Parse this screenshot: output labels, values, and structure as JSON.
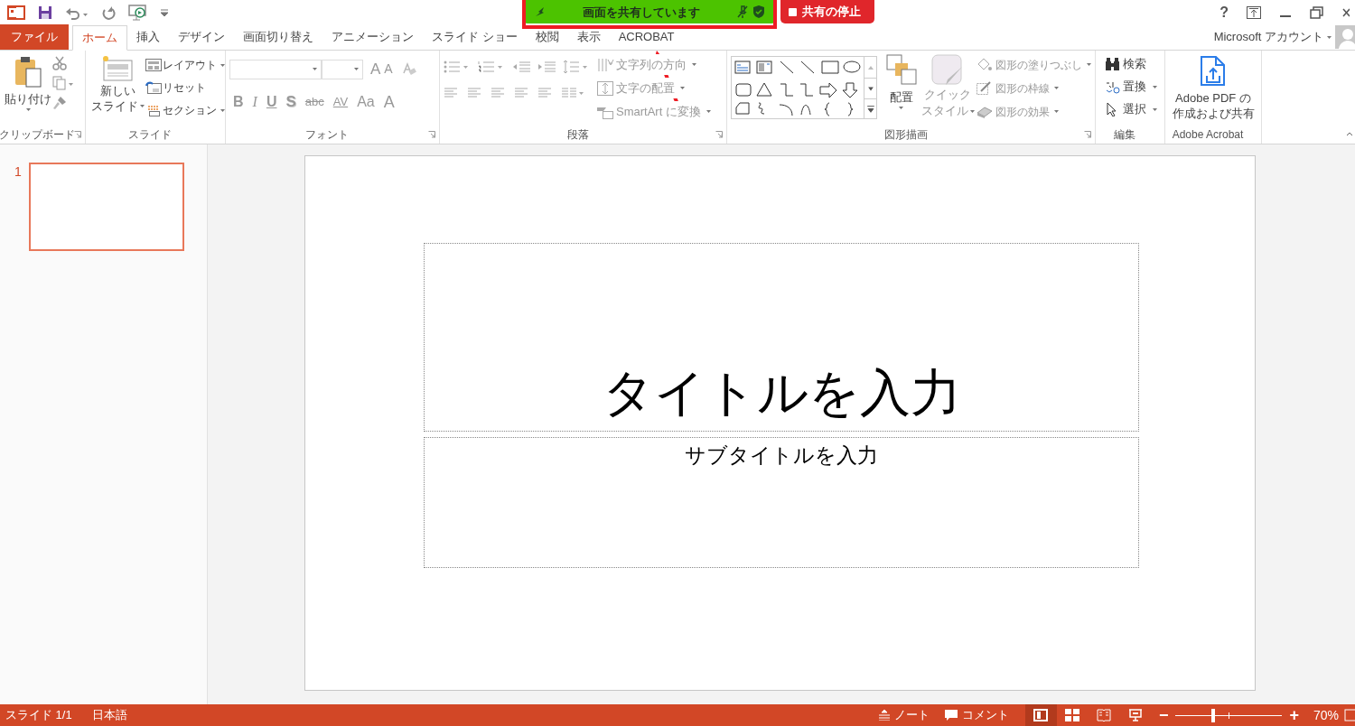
{
  "sharing_bar": {
    "status": "画面を共有しています",
    "stop_button": "共有の停止"
  },
  "window_controls": {
    "help": "?"
  },
  "tabs": [
    {
      "label": "ファイル",
      "kind": "file",
      "selected": false
    },
    {
      "label": "ホーム",
      "kind": "tab",
      "selected": true
    },
    {
      "label": "挿入",
      "kind": "tab",
      "selected": false
    },
    {
      "label": "デザイン",
      "kind": "tab",
      "selected": false
    },
    {
      "label": "画面切り替え",
      "kind": "tab",
      "selected": false
    },
    {
      "label": "アニメーション",
      "kind": "tab",
      "selected": false
    },
    {
      "label": "スライド ショー",
      "kind": "tab",
      "selected": false
    },
    {
      "label": "校閲",
      "kind": "tab",
      "selected": false
    },
    {
      "label": "表示",
      "kind": "tab",
      "selected": false
    },
    {
      "label": "ACROBAT",
      "kind": "tab",
      "selected": false
    }
  ],
  "account": "Microsoft アカウント",
  "ribbon": {
    "clipboard": {
      "label": "クリップボード",
      "paste": "貼り付け"
    },
    "slides": {
      "label": "スライド",
      "new_slide": [
        "新しい",
        "スライド"
      ],
      "commands": [
        "レイアウト",
        "リセット",
        "セクション"
      ]
    },
    "font": {
      "label": "フォント",
      "grow": "A",
      "shrink": "A",
      "buttons": [
        {
          "text": "B",
          "kind": "bold"
        },
        {
          "text": "I",
          "kind": "italic"
        },
        {
          "text": "U",
          "kind": "underline"
        },
        {
          "text": "S",
          "kind": "shadow"
        },
        {
          "text": "abc",
          "kind": "strike"
        },
        {
          "text": "AV",
          "kind": "spacing"
        },
        {
          "text": "Aa",
          "kind": "case"
        },
        {
          "text": "A",
          "kind": "color"
        }
      ]
    },
    "paragraph": {
      "label": "段落",
      "commands": [
        "文字列の方向",
        "文字の配置",
        "SmartArt に変換"
      ]
    },
    "drawing": {
      "label": "図形描画",
      "arrange": "配置",
      "quick_style": [
        "クイック",
        "スタイル"
      ],
      "commands": [
        "図形の塗りつぶし",
        "図形の枠線",
        "図形の効果"
      ]
    },
    "editing": {
      "label": "編集",
      "commands": [
        "検索",
        "置換",
        "選択"
      ]
    },
    "acrobat": {
      "label": "Adobe Acrobat",
      "button": [
        "Adobe PDF の",
        "作成および共有"
      ]
    }
  },
  "thumbnails": [
    {
      "number": "1",
      "selected": true
    }
  ],
  "slide": {
    "title_placeholder": "タイトルを入力",
    "subtitle_placeholder": "サブタイトルを入力"
  },
  "status_bar": {
    "slide": "スライド 1/1",
    "language": "日本語",
    "notes": "ノート",
    "comments": "コメント",
    "views": [
      {
        "kind": "normal",
        "selected": true
      },
      {
        "kind": "sorter",
        "selected": false
      },
      {
        "kind": "reading",
        "selected": false
      },
      {
        "kind": "show",
        "selected": false
      }
    ],
    "zoom_out": "−",
    "zoom_in": "+",
    "zoom": {
      "level": 0.35,
      "reading": "70%"
    }
  }
}
